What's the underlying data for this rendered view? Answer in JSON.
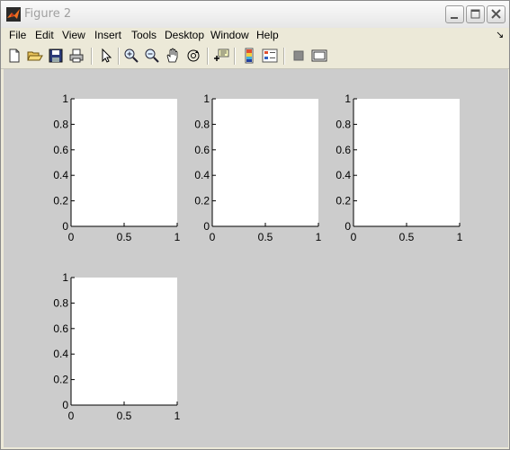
{
  "window": {
    "title": "Figure 2"
  },
  "menu": [
    "File",
    "Edit",
    "View",
    "Insert",
    "Tools",
    "Desktop",
    "Window",
    "Help"
  ],
  "toolbar_icons": [
    "new-figure-icon",
    "open-file-icon",
    "save-figure-icon",
    "print-figure-icon",
    "edit-plot-icon",
    "zoom-in-icon",
    "zoom-out-icon",
    "pan-icon",
    "rotate-3d-icon",
    "data-cursor-icon",
    "insert-colorbar-icon",
    "insert-legend-icon",
    "hide-plot-tools-icon",
    "show-plot-tools-icon"
  ],
  "colors": {
    "figure_bg": "#cccccc",
    "axes_bg": "#ffffff",
    "window_bg": "#ece9d8"
  },
  "chart_data": [
    {
      "type": "line",
      "series": [],
      "xlim": [
        0,
        1
      ],
      "ylim": [
        0,
        1
      ],
      "xticks": [
        "0",
        "0.5",
        "1"
      ],
      "yticks": [
        "0",
        "0.2",
        "0.4",
        "0.6",
        "0.8",
        "1"
      ],
      "grid": false
    },
    {
      "type": "line",
      "series": [],
      "xlim": [
        0,
        1
      ],
      "ylim": [
        0,
        1
      ],
      "xticks": [
        "0",
        "0.5",
        "1"
      ],
      "yticks": [
        "0",
        "0.2",
        "0.4",
        "0.6",
        "0.8",
        "1"
      ],
      "grid": false
    },
    {
      "type": "line",
      "series": [],
      "xlim": [
        0,
        1
      ],
      "ylim": [
        0,
        1
      ],
      "xticks": [
        "0",
        "0.5",
        "1"
      ],
      "yticks": [
        "0",
        "0.2",
        "0.4",
        "0.6",
        "0.8",
        "1"
      ],
      "grid": false
    },
    {
      "type": "line",
      "series": [],
      "xlim": [
        0,
        1
      ],
      "ylim": [
        0,
        1
      ],
      "xticks": [
        "0",
        "0.5",
        "1"
      ],
      "yticks": [
        "0",
        "0.2",
        "0.4",
        "0.6",
        "0.8",
        "1"
      ],
      "grid": false
    }
  ]
}
